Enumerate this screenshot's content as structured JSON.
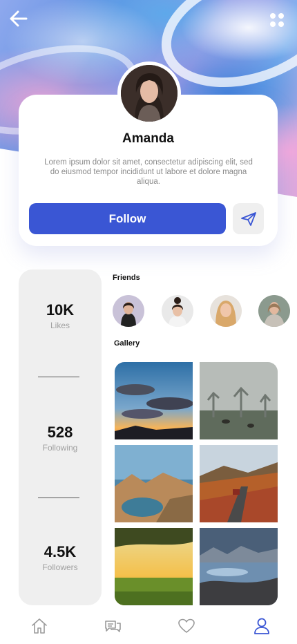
{
  "profile": {
    "name": "Amanda",
    "bio": "Lorem ipsum dolor sit amet, consectetur adipiscing elit, sed do eiusmod tempor incididunt ut labore et dolore magna aliqua.",
    "follow_label": "Follow"
  },
  "stats": [
    {
      "value": "10K",
      "label": "Likes"
    },
    {
      "value": "528",
      "label": "Following"
    },
    {
      "value": "4.5K",
      "label": "Followers"
    }
  ],
  "friends_title": "Friends",
  "gallery_title": "Gallery",
  "colors": {
    "accent": "#3a56d4",
    "stat_bg": "#efefef",
    "muted_text": "#8a8a8a"
  },
  "icons": {
    "back": "arrow-left-icon",
    "more": "four-dots-icon",
    "send": "paper-plane-icon",
    "nav": [
      "home-icon",
      "chat-icon",
      "heart-icon",
      "user-icon"
    ]
  },
  "nav": {
    "active": "profile"
  }
}
